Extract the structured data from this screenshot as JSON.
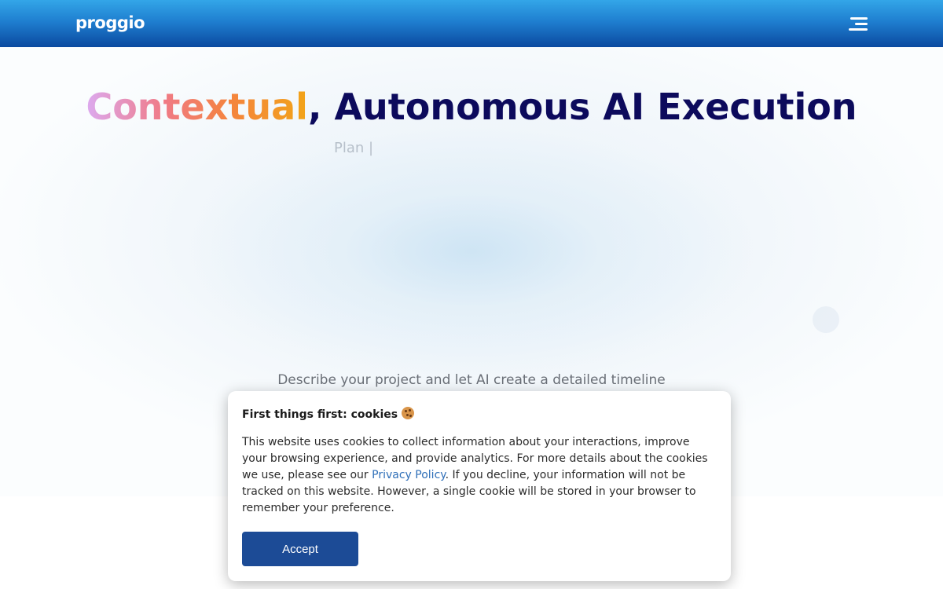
{
  "header": {
    "logo_text": "proggio",
    "menu_icon": "hamburger-menu-icon"
  },
  "hero": {
    "title_highlight": "Contextual",
    "title_rest": ", Autonomous AI Execution",
    "typing_text": "Plan |",
    "subtitle": "Describe your project and let AI create a detailed timeline"
  },
  "cookie_banner": {
    "title": "First things first: cookies",
    "title_icon": "cookie-icon",
    "text_before_link": "This website uses cookies to collect information about your interactions, improve your browsing experience, and provide analytics. For more details about the cookies we use, please see our ",
    "link_text": "Privacy Policy",
    "text_after_link": ". If you decline, your information will not be tracked on this website. However, a single cookie will be stored in your browser to remember your preference.",
    "accept_label": "Accept"
  },
  "colors": {
    "header_top": "#33a6e8",
    "header_bottom": "#0b4aa0",
    "title_navy": "#0c0a5c",
    "accent_gradient": [
      "#dcaaf0",
      "#f07a86",
      "#f4843e",
      "#f2a418"
    ],
    "accept_button": "#1c4b96",
    "link": "#2f6fb8"
  }
}
